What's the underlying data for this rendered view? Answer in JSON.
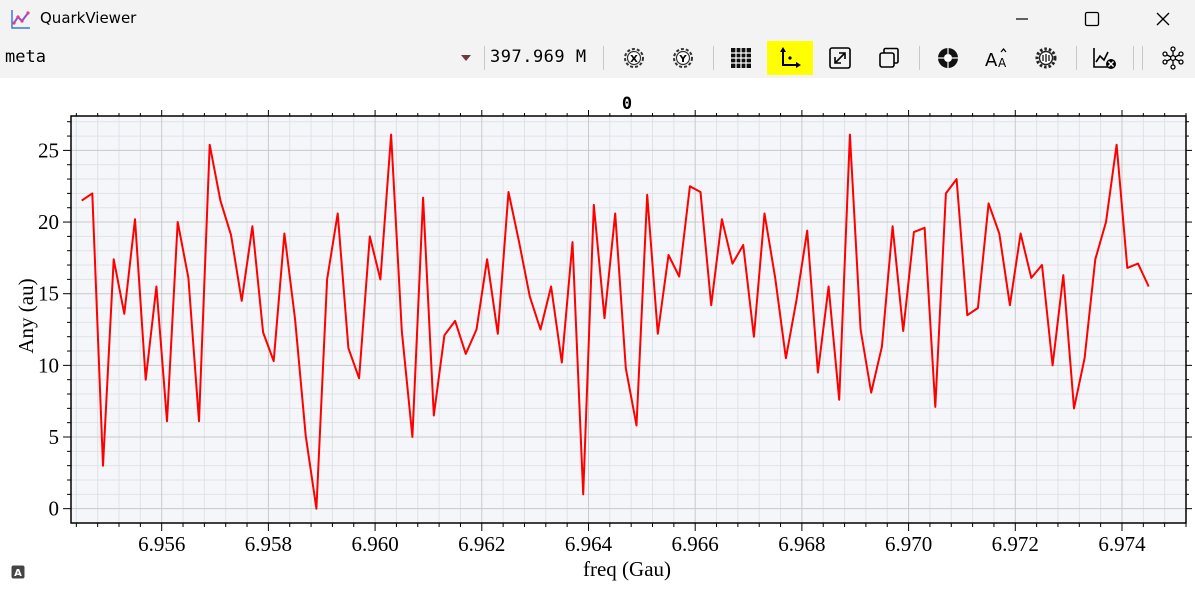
{
  "window": {
    "title": "QuarkViewer",
    "icon": "chart-line-icon",
    "controls": [
      "minimize-icon",
      "maximize-icon",
      "close-icon"
    ]
  },
  "toolbar": {
    "channel": "meta",
    "frequency": "397.969 M",
    "buttons": [
      {
        "name": "x-autoscale-button",
        "icon": "gear-x-icon",
        "active": false
      },
      {
        "name": "y-autoscale-button",
        "icon": "gear-y-icon",
        "active": false
      },
      {
        "name": "grid-button",
        "icon": "grid-icon",
        "active": false
      },
      {
        "name": "axes-button",
        "icon": "axes-icon",
        "active": true
      },
      {
        "name": "expand-button",
        "icon": "expand-icon",
        "active": false
      },
      {
        "name": "copy-button",
        "icon": "copy-window-icon",
        "active": false
      },
      {
        "name": "color-button",
        "icon": "color-wheel-icon",
        "active": false
      },
      {
        "name": "font-button",
        "icon": "font-size-icon",
        "active": false
      },
      {
        "name": "settings-button",
        "icon": "settings-gear-icon",
        "active": false
      },
      {
        "name": "clear-plot-button",
        "icon": "chart-clear-icon",
        "active": false
      },
      {
        "name": "network-button",
        "icon": "network-icon",
        "active": false
      }
    ],
    "active_color": "#ffff00"
  },
  "chart_data": {
    "type": "line",
    "title": "0",
    "xlabel": "freq (Gau)",
    "ylabel": "Any (au)",
    "xlim": [
      6.9543,
      6.9752
    ],
    "ylim": [
      -1,
      27.4
    ],
    "xticks": [
      "6.956",
      "6.958",
      "6.960",
      "6.962",
      "6.964",
      "6.966",
      "6.968",
      "6.970",
      "6.972",
      "6.974"
    ],
    "yticks": [
      "0",
      "5",
      "10",
      "15",
      "20",
      "25"
    ],
    "grid": true,
    "series": [
      {
        "color": "#ff0000",
        "x_start": 6.9545,
        "x_step": 0.0002,
        "values": [
          21.5,
          22.0,
          3.0,
          17.4,
          13.6,
          20.2,
          9.0,
          15.5,
          6.1,
          20.0,
          16.1,
          6.1,
          25.4,
          21.5,
          19.1,
          14.5,
          19.7,
          12.3,
          10.3,
          19.2,
          13.2,
          5.1,
          0.0,
          16.0,
          20.6,
          11.2,
          9.1,
          19.0,
          16.0,
          26.1,
          12.4,
          5.0,
          21.7,
          6.5,
          12.1,
          13.1,
          10.8,
          12.5,
          17.4,
          12.2,
          22.1,
          18.6,
          14.8,
          12.5,
          15.5,
          10.2,
          18.6,
          1.0,
          21.2,
          13.3,
          20.6,
          9.8,
          5.8,
          21.9,
          12.2,
          17.7,
          16.2,
          22.5,
          22.1,
          14.2,
          20.2,
          17.1,
          18.4,
          12.0,
          20.6,
          16.1,
          10.5,
          14.6,
          19.4,
          9.5,
          15.5,
          7.6,
          26.1,
          12.5,
          8.1,
          11.3,
          19.7,
          12.4,
          19.3,
          19.6,
          7.1,
          22.0,
          23.0,
          13.5,
          14.0,
          21.3,
          19.2,
          14.2,
          19.2,
          16.1,
          17.0,
          10.0,
          16.3,
          7.0,
          10.5,
          17.4,
          20.0,
          25.4,
          16.8,
          17.1,
          15.5
        ]
      }
    ]
  }
}
